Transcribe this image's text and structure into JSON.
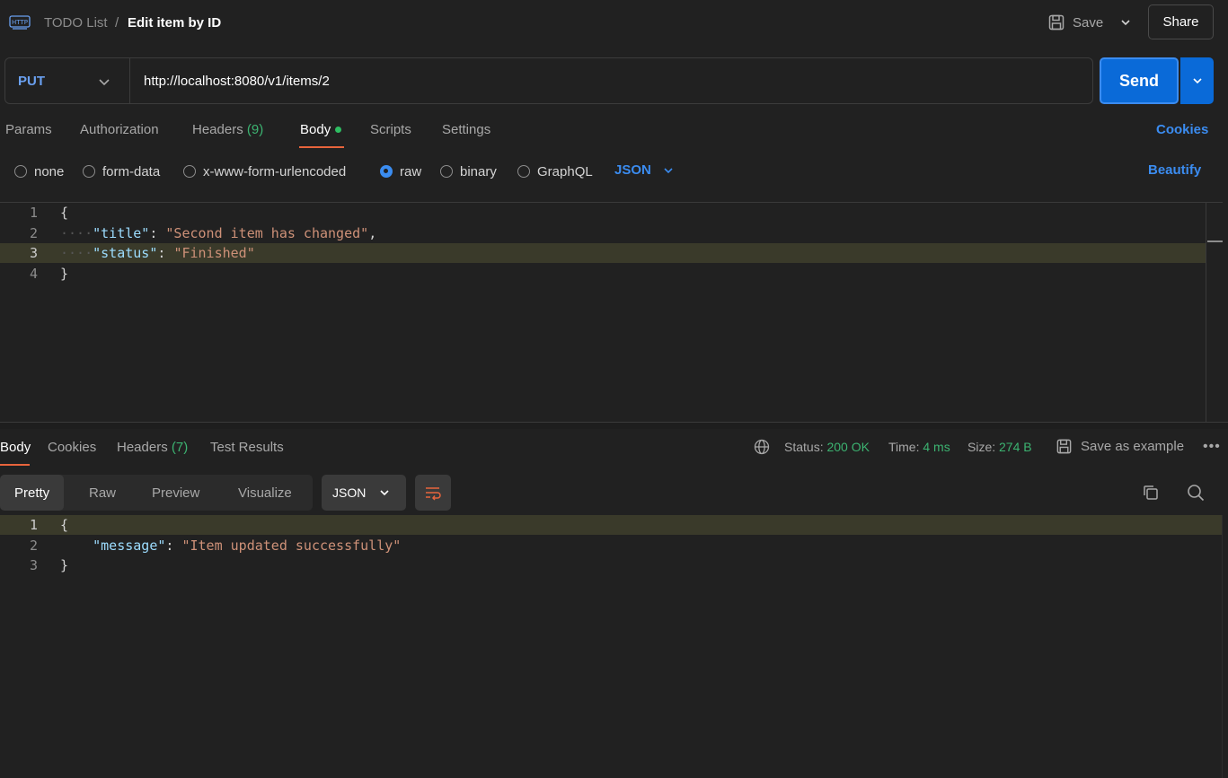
{
  "header": {
    "breadcrumb_parent": "TODO List",
    "breadcrumb_sep": "/",
    "title": "Edit item by ID",
    "save_label": "Save",
    "share_label": "Share"
  },
  "request": {
    "method": "PUT",
    "url": "http://localhost:8080/v1/items/2",
    "send_label": "Send"
  },
  "request_tabs": {
    "params": "Params",
    "authorization": "Authorization",
    "headers": "Headers",
    "headers_count": "(9)",
    "body": "Body",
    "scripts": "Scripts",
    "settings": "Settings",
    "cookies": "Cookies"
  },
  "body_types": {
    "none": "none",
    "form_data": "form-data",
    "urlencoded": "x-www-form-urlencoded",
    "raw": "raw",
    "binary": "binary",
    "graphql": "GraphQL",
    "selected": "raw",
    "format": "JSON",
    "beautify": "Beautify"
  },
  "request_body": {
    "line_numbers": [
      "1",
      "2",
      "3",
      "4"
    ],
    "open_brace": "{",
    "title_key": "\"title\"",
    "title_value": "\"Second item has changed\"",
    "status_key": "\"status\"",
    "status_value": "\"Finished\"",
    "close_brace": "}"
  },
  "response_tabs": {
    "body": "Body",
    "cookies": "Cookies",
    "headers": "Headers",
    "headers_count": "(7)",
    "test_results": "Test Results"
  },
  "response_meta": {
    "status_label": "Status:",
    "status_value": "200 OK",
    "time_label": "Time:",
    "time_value": "4 ms",
    "size_label": "Size:",
    "size_value": "274 B",
    "save_example": "Save as example",
    "more": "•••"
  },
  "response_view": {
    "pretty": "Pretty",
    "raw": "Raw",
    "preview": "Preview",
    "visualize": "Visualize",
    "format": "JSON"
  },
  "response_body": {
    "line_numbers": [
      "1",
      "2",
      "3"
    ],
    "open_brace": "{",
    "message_key": "\"message\"",
    "message_value": "\"Item updated successfully\"",
    "close_brace": "}"
  },
  "colors": {
    "accent_blue": "#0a6ad8",
    "link_blue": "#3b8cf0",
    "success_green": "#3cb371",
    "tab_underline": "#e8643c",
    "method_blue": "#6aa0f0"
  },
  "icons": [
    "http-icon",
    "save-icon",
    "chevron-down-icon",
    "globe-icon",
    "save-example-icon",
    "more-icon",
    "wrap-icon",
    "copy-icon",
    "search-icon"
  ]
}
